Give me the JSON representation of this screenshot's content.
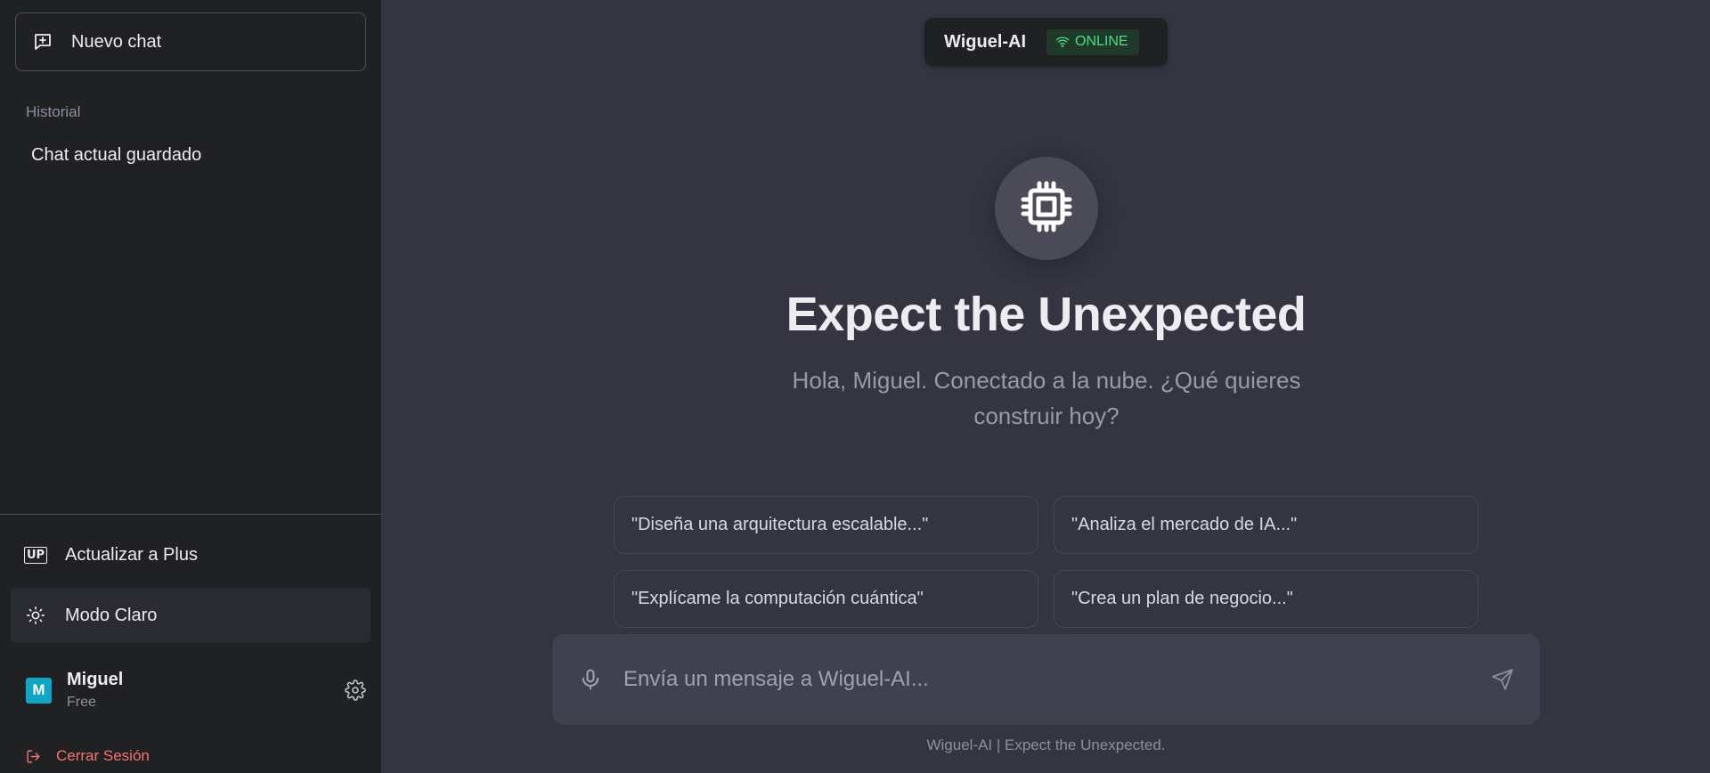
{
  "sidebar": {
    "new_chat_label": "Nuevo chat",
    "history_label": "Historial",
    "history_items": [
      {
        "label": "Chat actual guardado"
      }
    ],
    "upgrade_badge": "UP",
    "upgrade_label": "Actualizar a Plus",
    "theme_label": "Modo Claro",
    "user": {
      "initial": "M",
      "name": "Miguel",
      "plan": "Free"
    },
    "logout_label": "Cerrar Sesión"
  },
  "header": {
    "brand": "Wiguel-AI",
    "status": "ONLINE",
    "status_color": "#4ade80"
  },
  "hero": {
    "title": "Expect the Unexpected",
    "subtitle": "Hola, Miguel. Conectado a la nube. ¿Qué quieres construir hoy?"
  },
  "suggestions": [
    {
      "label": "\"Diseña una arquitectura escalable...\""
    },
    {
      "label": "\"Analiza el mercado de IA...\""
    },
    {
      "label": "\"Explícame la computación cuántica\""
    },
    {
      "label": "\"Crea un plan de negocio...\""
    }
  ],
  "composer": {
    "placeholder": "Envía un mensaje a Wiguel-AI..."
  },
  "footer": "Wiguel-AI | Expect the Unexpected.",
  "icons": {
    "new_chat": "message-plus-icon",
    "theme": "sun-icon",
    "settings": "gear-icon",
    "logout": "logout-icon",
    "status": "wifi-icon",
    "logo": "cpu-chip-icon",
    "mic": "microphone-icon",
    "send": "send-icon"
  },
  "colors": {
    "sidebar_bg": "#202123",
    "main_bg": "#343541",
    "avatar": "#0ea5c6",
    "logout": "#f87171"
  }
}
